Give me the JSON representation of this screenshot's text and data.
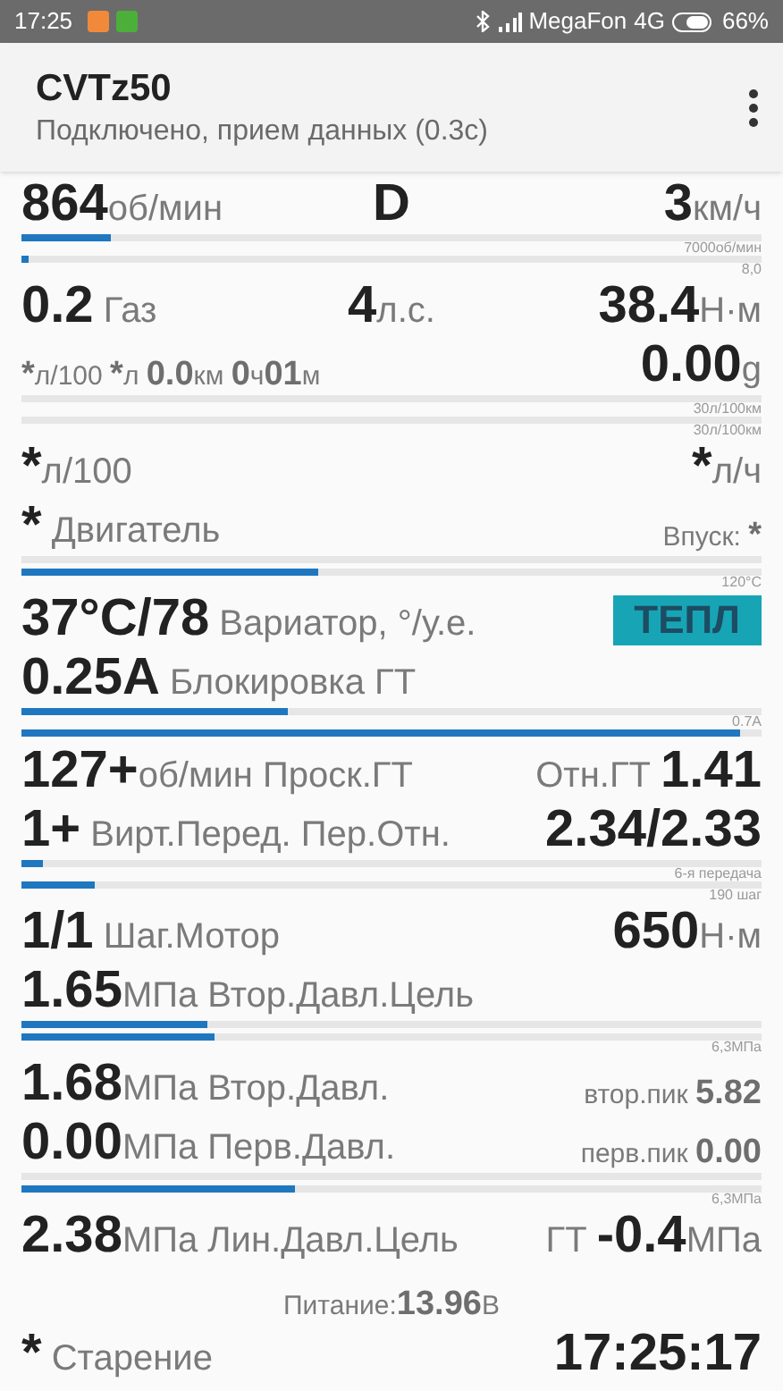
{
  "status_bar": {
    "time": "17:25",
    "operator": "MegaFon",
    "network": "4G",
    "battery": "66%"
  },
  "app_bar": {
    "title": "CVTz50",
    "subtitle": "Подключено, прием данных (0.3с)"
  },
  "items": [
    {
      "kind": "row",
      "left": [
        {
          "kind": "value",
          "text": "864"
        },
        {
          "kind": "unit",
          "text": "об/мин"
        }
      ],
      "center": [
        {
          "kind": "value",
          "text": "D"
        }
      ],
      "right": [
        {
          "kind": "value",
          "text": "3"
        },
        {
          "kind": "unit",
          "text": "км/ч"
        }
      ]
    },
    {
      "kind": "bar",
      "level": 0.12,
      "scale": "7000об/мин"
    },
    {
      "kind": "bar",
      "level": 0.01,
      "scale": "8,0"
    },
    {
      "kind": "row",
      "left": [
        {
          "kind": "value",
          "text": "0.2"
        },
        {
          "kind": "unit",
          "text": " Газ"
        }
      ],
      "center": [
        {
          "kind": "value",
          "text": "4"
        },
        {
          "kind": "unit",
          "text": "л.с."
        }
      ],
      "right": [
        {
          "kind": "value",
          "text": "38.4"
        },
        {
          "kind": "unit",
          "text": "Н·м"
        }
      ]
    },
    {
      "kind": "row",
      "left": [
        {
          "kind": "muted",
          "text": "*"
        },
        {
          "kind": "minor",
          "text": "л/100 "
        },
        {
          "kind": "muted",
          "text": "*"
        },
        {
          "kind": "minor",
          "text": "л "
        },
        {
          "kind": "muted",
          "text": "0.0"
        },
        {
          "kind": "minor",
          "text": "км "
        },
        {
          "kind": "muted",
          "text": "0"
        },
        {
          "kind": "minor",
          "text": "ч"
        },
        {
          "kind": "muted",
          "text": "01"
        },
        {
          "kind": "minor",
          "text": "м"
        }
      ],
      "right": [
        {
          "kind": "value",
          "text": "0.00"
        },
        {
          "kind": "unit",
          "text": "g"
        }
      ]
    },
    {
      "kind": "bar",
      "scale": "30л/100км"
    },
    {
      "kind": "bar",
      "scale": "30л/100км"
    },
    {
      "kind": "row",
      "left": [
        {
          "kind": "value",
          "text": "*"
        },
        {
          "kind": "unit",
          "text": "л/100"
        }
      ],
      "right": [
        {
          "kind": "value",
          "text": "*"
        },
        {
          "kind": "unit",
          "text": "л/ч"
        }
      ]
    },
    {
      "kind": "row",
      "left": [
        {
          "kind": "value",
          "text": "*"
        },
        {
          "kind": "unit",
          "text": " Двигатель"
        }
      ],
      "right": [
        {
          "kind": "small",
          "text": "Впуск: "
        },
        {
          "kind": "muted",
          "text": "*"
        }
      ]
    },
    {
      "kind": "bar"
    },
    {
      "kind": "bar",
      "level": 0.4,
      "scale": "120°C"
    },
    {
      "kind": "row",
      "left": [
        {
          "kind": "value",
          "text": "37°C/78"
        },
        {
          "kind": "unit",
          "text": " Вариатор, °/у.е."
        }
      ],
      "right": [
        {
          "kind": "badge",
          "text": "ТЕПЛ"
        }
      ]
    },
    {
      "kind": "row",
      "left": [
        {
          "kind": "value",
          "text": "0.25A"
        },
        {
          "kind": "unit",
          "text": " Блокировка ГТ"
        }
      ]
    },
    {
      "kind": "bar",
      "level": 0.36,
      "scale": "0.7A"
    },
    {
      "kind": "bar",
      "level": 0.97
    },
    {
      "kind": "row",
      "left": [
        {
          "kind": "value",
          "text": "127+"
        },
        {
          "kind": "unit",
          "text": "об/мин Проск.ГТ"
        }
      ],
      "right": [
        {
          "kind": "unit",
          "text": "Отн.ГТ "
        },
        {
          "kind": "value",
          "text": "1.41"
        }
      ]
    },
    {
      "kind": "row",
      "left": [
        {
          "kind": "value",
          "text": "1+"
        },
        {
          "kind": "unit",
          "text": " Вирт.Перед. Пер.Отн."
        }
      ],
      "right": [
        {
          "kind": "value",
          "text": "2.34/2.33"
        }
      ]
    },
    {
      "kind": "bar",
      "level": 0.03,
      "scale": "6-я передача"
    },
    {
      "kind": "bar",
      "level": 0.1,
      "scale": "190 шаг"
    },
    {
      "kind": "row",
      "left": [
        {
          "kind": "value",
          "text": "1/1"
        },
        {
          "kind": "unit",
          "text": " Шаг.Мотор"
        }
      ],
      "right": [
        {
          "kind": "value",
          "text": "650"
        },
        {
          "kind": "unit",
          "text": "Н·м"
        }
      ]
    },
    {
      "kind": "row",
      "left": [
        {
          "kind": "value",
          "text": "1.65"
        },
        {
          "kind": "unit",
          "text": "МПа Втор.Давл.Цель"
        }
      ]
    },
    {
      "kind": "bar",
      "level": 0.25
    },
    {
      "kind": "bar",
      "level": 0.26,
      "scale": "6,3МПа"
    },
    {
      "kind": "row",
      "left": [
        {
          "kind": "value",
          "text": "1.68"
        },
        {
          "kind": "unit",
          "text": "МПа Втор.Давл."
        }
      ],
      "right": [
        {
          "kind": "small",
          "text": "втор.пик "
        },
        {
          "kind": "muted",
          "text": "5.82"
        }
      ]
    },
    {
      "kind": "row",
      "left": [
        {
          "kind": "value",
          "text": "0.00"
        },
        {
          "kind": "unit",
          "text": "МПа Перв.Давл."
        }
      ],
      "right": [
        {
          "kind": "small",
          "text": "перв.пик "
        },
        {
          "kind": "muted",
          "text": "0.00"
        }
      ]
    },
    {
      "kind": "bar"
    },
    {
      "kind": "bar",
      "level": 0.37,
      "scale": "6,3МПа"
    },
    {
      "kind": "row",
      "left": [
        {
          "kind": "value",
          "text": "2.38"
        },
        {
          "kind": "unit",
          "text": "МПа Лин.Давл.Цель"
        }
      ],
      "right": [
        {
          "kind": "unit",
          "text": "ГТ "
        },
        {
          "kind": "value",
          "text": "-0.4"
        },
        {
          "kind": "unit",
          "text": "МПа"
        }
      ]
    },
    {
      "kind": "row",
      "center": [
        {
          "kind": "small",
          "text": "Питание:"
        },
        {
          "kind": "muted",
          "text": "13.96"
        },
        {
          "kind": "small",
          "text": "В"
        }
      ]
    },
    {
      "kind": "row",
      "left": [
        {
          "kind": "value",
          "text": "*"
        },
        {
          "kind": "unit",
          "text": " Старение"
        }
      ],
      "right": [
        {
          "kind": "value",
          "text": "17:25:17"
        }
      ]
    }
  ]
}
